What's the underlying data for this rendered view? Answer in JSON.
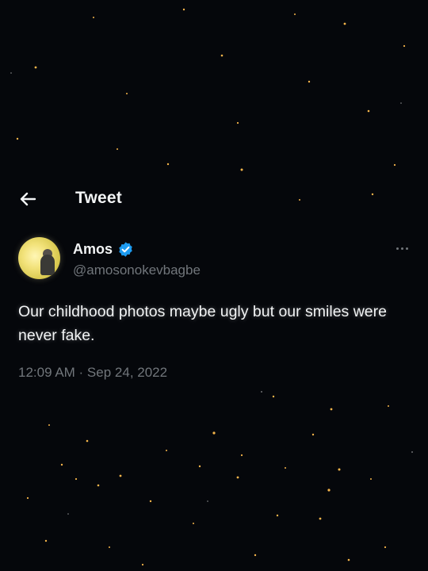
{
  "header": {
    "title": "Tweet",
    "back_icon": "arrow-left-icon"
  },
  "tweet": {
    "author": {
      "name": "Amos",
      "handle": "@amosonokevbagbe",
      "verified": true,
      "verified_color": "#1d9bf0"
    },
    "text": "Our childhood photos maybe ugly but our smiles were never fake.",
    "timestamp": "12:09 AM · Sep 24, 2022"
  },
  "colors": {
    "background": "#05070b",
    "primary_text": "#f2f4f5",
    "secondary_text": "#71767b",
    "sparkle": "#f5b54a"
  }
}
